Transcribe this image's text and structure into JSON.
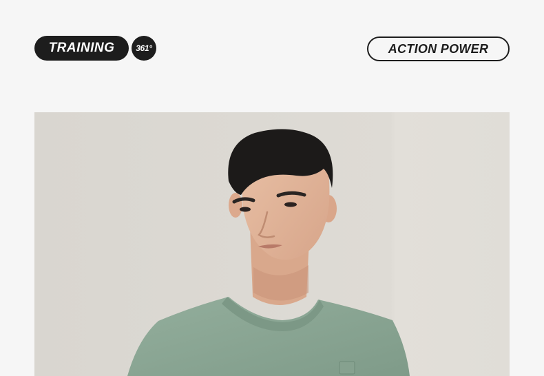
{
  "header": {
    "training_label": "TRAINING",
    "brand_badge": "361°",
    "action_label": "ACTION POWER"
  },
  "photo": {
    "subject": "man-in-green-sweatshirt"
  },
  "colors": {
    "background": "#f6f6f6",
    "pill_dark": "#1d1d1d",
    "photo_backdrop": "#dcd8d2",
    "sweatshirt_green": "#8aa593"
  }
}
